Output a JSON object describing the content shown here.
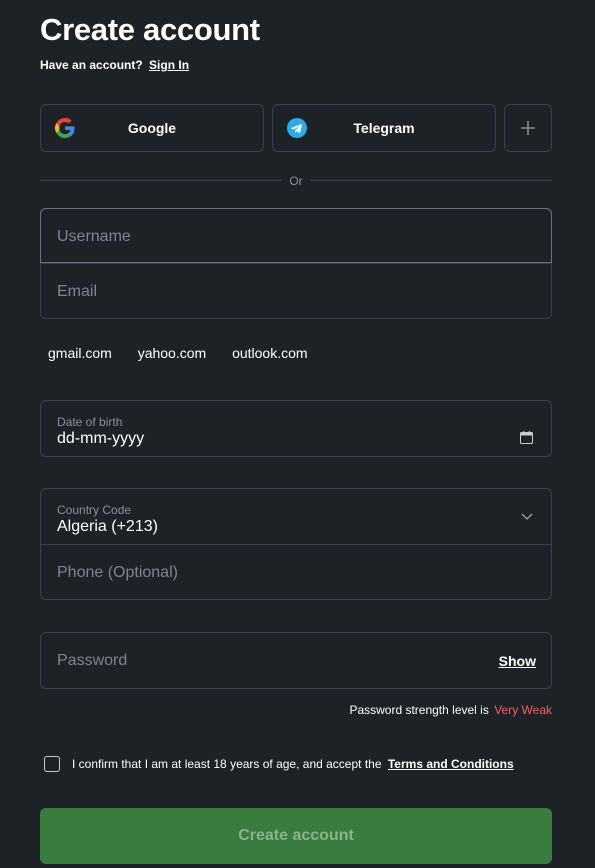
{
  "header": {
    "title": "Create account",
    "have_account_text": "Have an account?",
    "sign_in_label": "Sign In"
  },
  "social": {
    "google_label": "Google",
    "telegram_label": "Telegram",
    "more_icon": "plus-icon"
  },
  "divider": {
    "or_text": "Or"
  },
  "form": {
    "username_placeholder": "Username",
    "email_placeholder": "Email",
    "email_domains": [
      "gmail.com",
      "yahoo.com",
      "outlook.com"
    ],
    "dob_label": "Date of birth",
    "dob_value": "dd-mm-yyyy",
    "country_label": "Country Code",
    "country_value": "Algeria (+213)",
    "phone_placeholder": "Phone (Optional)",
    "password_placeholder": "Password",
    "show_label": "Show",
    "strength_text": "Password strength level is",
    "strength_value": "Very Weak",
    "confirm_text": "I confirm that I am at least 18 years of age, and accept the",
    "terms_label": "Terms and Conditions",
    "submit_label": "Create account"
  },
  "colors": {
    "background": "#1d2227",
    "border": "#3a4148",
    "submit_bg": "#3a7c3f",
    "submit_text": "#8ab48c",
    "weak": "#ff5a5f"
  }
}
